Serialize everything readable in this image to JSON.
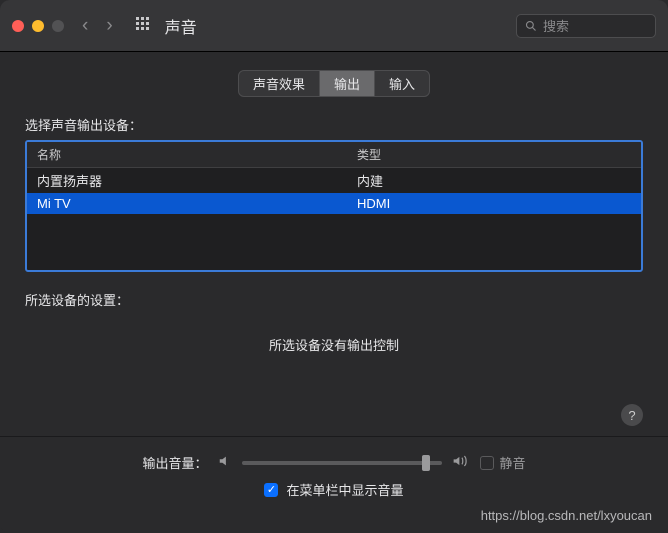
{
  "titlebar": {
    "title": "声音",
    "search_placeholder": "搜索"
  },
  "tabs": {
    "effects": "声音效果",
    "output": "输出",
    "input": "输入",
    "active": "output"
  },
  "section": {
    "select_output_label": "选择声音输出设备：",
    "col_name": "名称",
    "col_type": "类型",
    "devices": [
      {
        "name": "内置扬声器",
        "type": "内建",
        "selected": false
      },
      {
        "name": "Mi TV",
        "type": "HDMI",
        "selected": true
      }
    ]
  },
  "settings": {
    "label": "所选设备的设置：",
    "no_control": "所选设备没有输出控制"
  },
  "volume": {
    "label": "输出音量：",
    "position_pct": 92,
    "mute_label": "静音",
    "mute_checked": false,
    "menubar_label": "在菜单栏中显示音量",
    "menubar_checked": true
  },
  "help": {
    "glyph": "?"
  },
  "watermark": "https://blog.csdn.net/lxyoucan"
}
